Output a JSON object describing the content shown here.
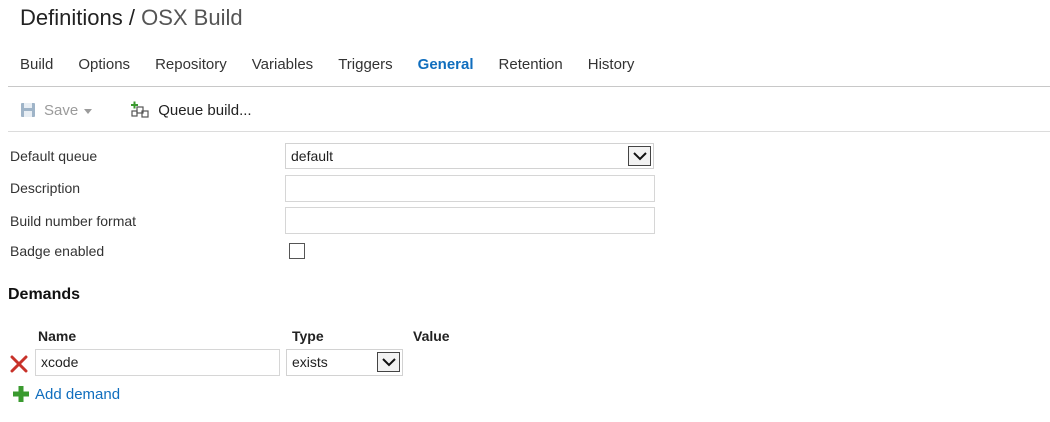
{
  "header": {
    "breadcrumb_root": "Definitions",
    "separator": "/",
    "current": "OSX Build"
  },
  "tabs": [
    {
      "label": "Build",
      "active": false
    },
    {
      "label": "Options",
      "active": false
    },
    {
      "label": "Repository",
      "active": false
    },
    {
      "label": "Variables",
      "active": false
    },
    {
      "label": "Triggers",
      "active": false
    },
    {
      "label": "General",
      "active": true
    },
    {
      "label": "Retention",
      "active": false
    },
    {
      "label": "History",
      "active": false
    }
  ],
  "toolbar": {
    "save_label": "Save",
    "save_icon": "floppy-disk-icon",
    "queue_label": "Queue build...",
    "queue_icon": "queue-build-icon"
  },
  "general": {
    "default_queue_label": "Default queue",
    "default_queue_value": "default",
    "description_label": "Description",
    "description_value": "",
    "build_number_format_label": "Build number format",
    "build_number_format_value": "",
    "badge_enabled_label": "Badge enabled",
    "badge_enabled_checked": false
  },
  "demands": {
    "title": "Demands",
    "columns": {
      "name": "Name",
      "type": "Type",
      "value": "Value"
    },
    "rows": [
      {
        "name": "xcode",
        "type": "exists",
        "value": ""
      }
    ],
    "add_label": "Add demand",
    "delete_icon": "delete-x-icon",
    "add_icon": "plus-icon"
  },
  "colors": {
    "accent": "#106ebe",
    "delete": "#c8322a",
    "add": "#3a9a2f",
    "disabled": "#9b9b9b"
  }
}
